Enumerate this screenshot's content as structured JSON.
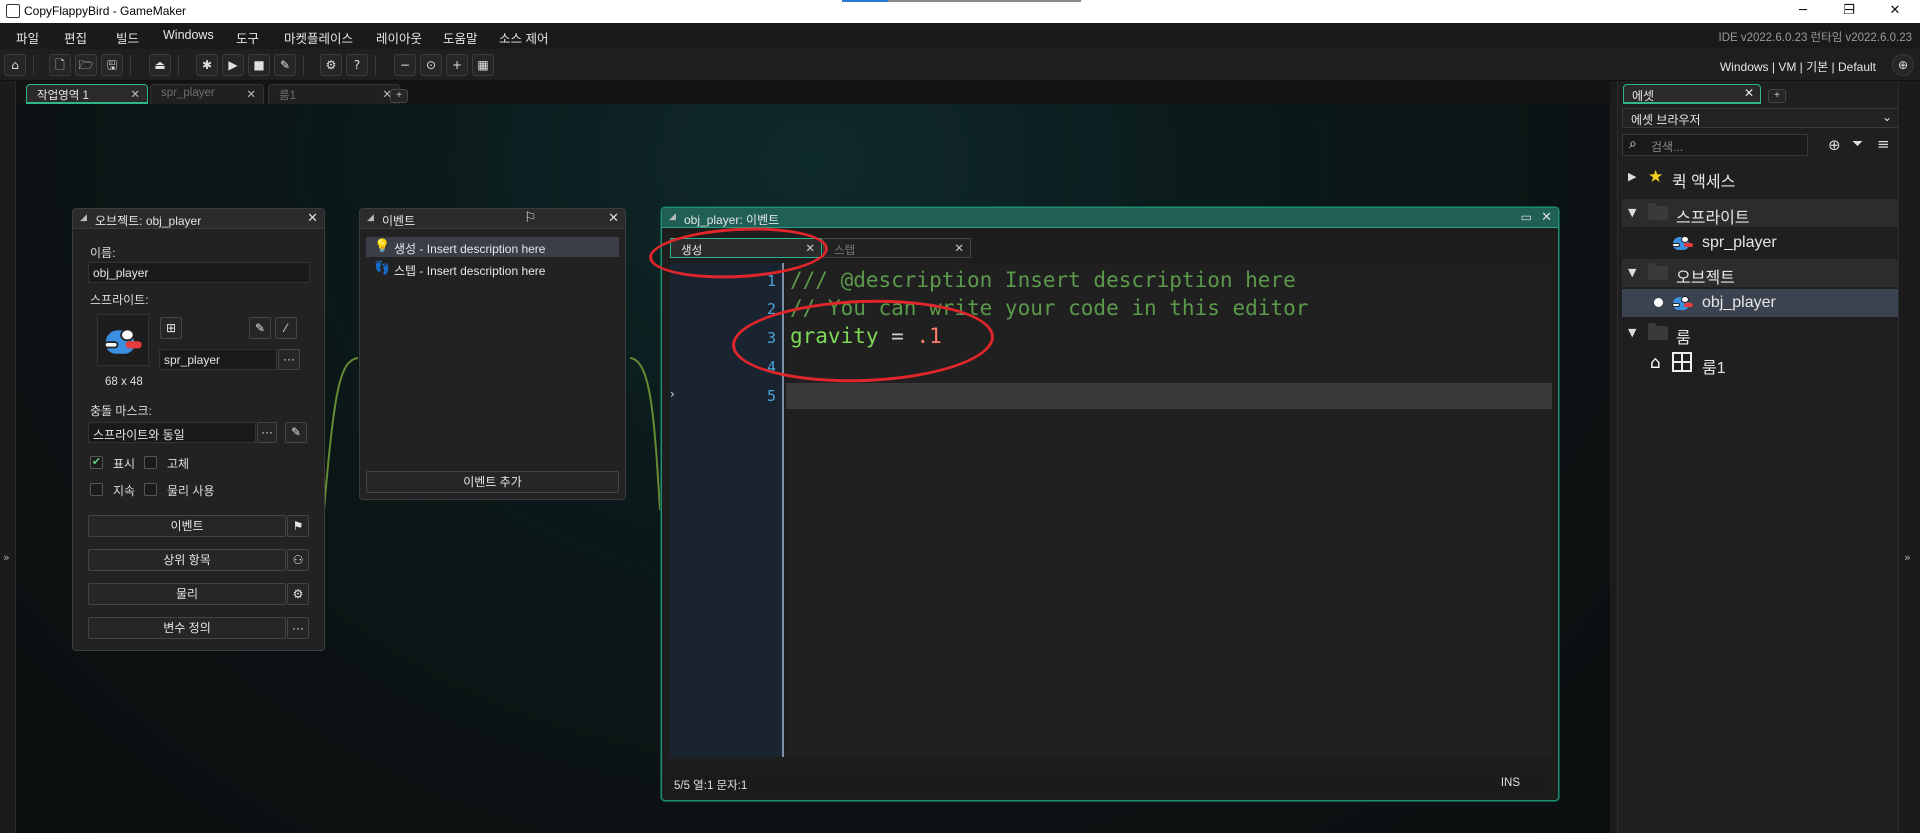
{
  "window": {
    "title": "CopyFlappyBird - GameMaker",
    "minimize": "─",
    "maximize": "❐",
    "close": "✕"
  },
  "menu": {
    "items": [
      "파일",
      "편집",
      "빌드",
      "Windows",
      "도구",
      "마켓플레이스",
      "레이아웃",
      "도움말",
      "소스 제어"
    ],
    "ide_version": "IDE v2022.6.0.23  런타임 v2022.6.0.23"
  },
  "toolbar": {
    "target": "Windows | VM | 기본 | Default"
  },
  "workspace_tabs": [
    {
      "label": "작업영역 1",
      "close": "✕"
    },
    {
      "label": "spr_player",
      "close": "✕"
    },
    {
      "label": "룸1",
      "close": "✕"
    }
  ],
  "workspace_add": "+",
  "object_panel": {
    "title": "오브젝트: obj_player",
    "name_label": "이름:",
    "name_value": "obj_player",
    "sprite_label": "스프라이트:",
    "sprite_value": "spr_player",
    "sprite_size": "68 x 48",
    "collision_label": "충돌 마스크:",
    "collision_value": "스프라이트와 동일",
    "visible_label": "표시",
    "visible_checked": true,
    "solid_label": "고체",
    "solid_checked": false,
    "persistent_label": "지속",
    "persistent_checked": false,
    "physics_label": "물리 사용",
    "physics_checked": false,
    "events_button": "이벤트",
    "parent_button": "상위 항목",
    "physics_button": "물리",
    "variables_button": "변수 정의",
    "more": "···"
  },
  "events_panel": {
    "title": "이벤트",
    "items": [
      {
        "label": "생성 - Insert description here"
      },
      {
        "label": "스텝 - Insert description here"
      }
    ],
    "add_button": "이벤트 추가"
  },
  "code_panel": {
    "title": "obj_player: 이벤트",
    "tabs": [
      {
        "label": "생성",
        "close": "✕"
      },
      {
        "label": "스텝",
        "close": "✕"
      }
    ],
    "line_numbers": [
      "1",
      "2",
      "3",
      "4",
      "5"
    ],
    "lines": {
      "l1": "/// @description Insert description here",
      "l2": "// You can write your code in this editor",
      "l3_var": "gravity",
      "l3_op": " = ",
      "l3_num": ".1"
    },
    "status_left": "5/5 열:1 문자:1",
    "status_right": "INS"
  },
  "asset_browser": {
    "tab": "에셋",
    "tab_close": "✕",
    "add": "+",
    "dropdown": "에셋 브라우저",
    "search_placeholder": "검색...",
    "quick_access": "퀵 액세스",
    "sprites_group": "스프라이트",
    "sprite_item": "spr_player",
    "objects_group": "오브젝트",
    "object_item": "obj_player",
    "rooms_group": "룸",
    "room_item": "룸1"
  },
  "colors": {
    "accent": "#2fb590",
    "annotation": "#e0262b",
    "comment": "#5b9a4a",
    "variable": "#7ed957",
    "number": "#ff7b6a",
    "line_number": "#4aa3d8"
  }
}
